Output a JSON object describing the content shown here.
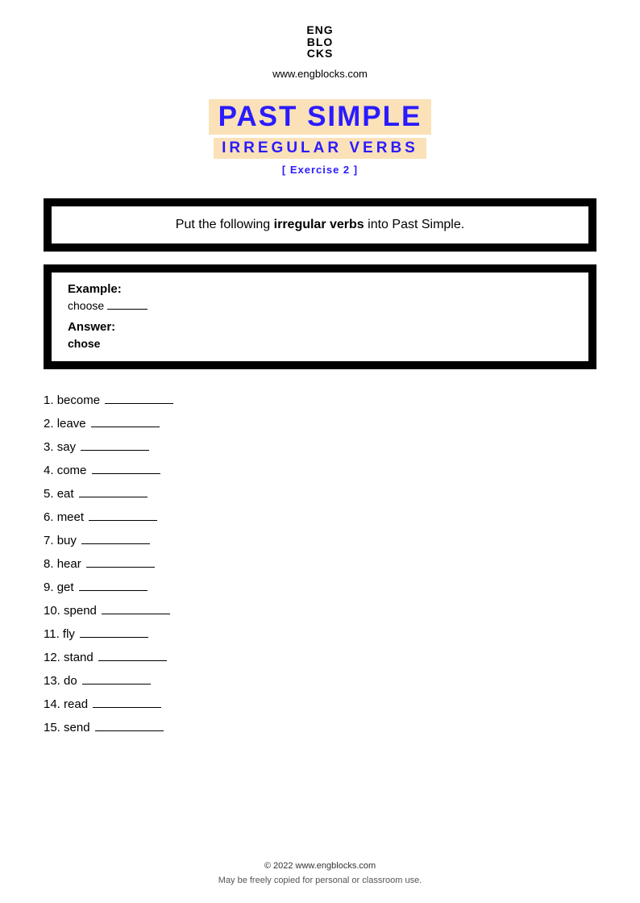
{
  "header": {
    "logo_line1": "ENG",
    "logo_line2": "BLO",
    "logo_line3": "CKS",
    "url": "www.engblocks.com"
  },
  "title": {
    "main": "PAST SIMPLE",
    "sub": "IRREGULAR VERBS",
    "exercise": "[ Exercise 2 ]"
  },
  "instruction": {
    "pre": "Put the following ",
    "bold": "irregular verbs",
    "post": " into Past Simple."
  },
  "example": {
    "example_label": "Example:",
    "example_word": "choose",
    "answer_label": "Answer:",
    "answer_word": "chose"
  },
  "questions": [
    {
      "n": "1.",
      "word": "become"
    },
    {
      "n": "2.",
      "word": "leave"
    },
    {
      "n": "3.",
      "word": "say"
    },
    {
      "n": "4.",
      "word": "come"
    },
    {
      "n": "5.",
      "word": "eat"
    },
    {
      "n": "6.",
      "word": "meet"
    },
    {
      "n": "7.",
      "word": "buy"
    },
    {
      "n": "8.",
      "word": "hear"
    },
    {
      "n": "9.",
      "word": "get"
    },
    {
      "n": "10.",
      "word": "spend"
    },
    {
      "n": "11.",
      "word": "fly"
    },
    {
      "n": "12.",
      "word": "stand"
    },
    {
      "n": "13.",
      "word": "do"
    },
    {
      "n": "14.",
      "word": "read"
    },
    {
      "n": "15.",
      "word": "send"
    }
  ],
  "footer": {
    "copyright": "© 2022 www.engblocks.com",
    "license": "May be freely copied for personal or classroom use."
  }
}
